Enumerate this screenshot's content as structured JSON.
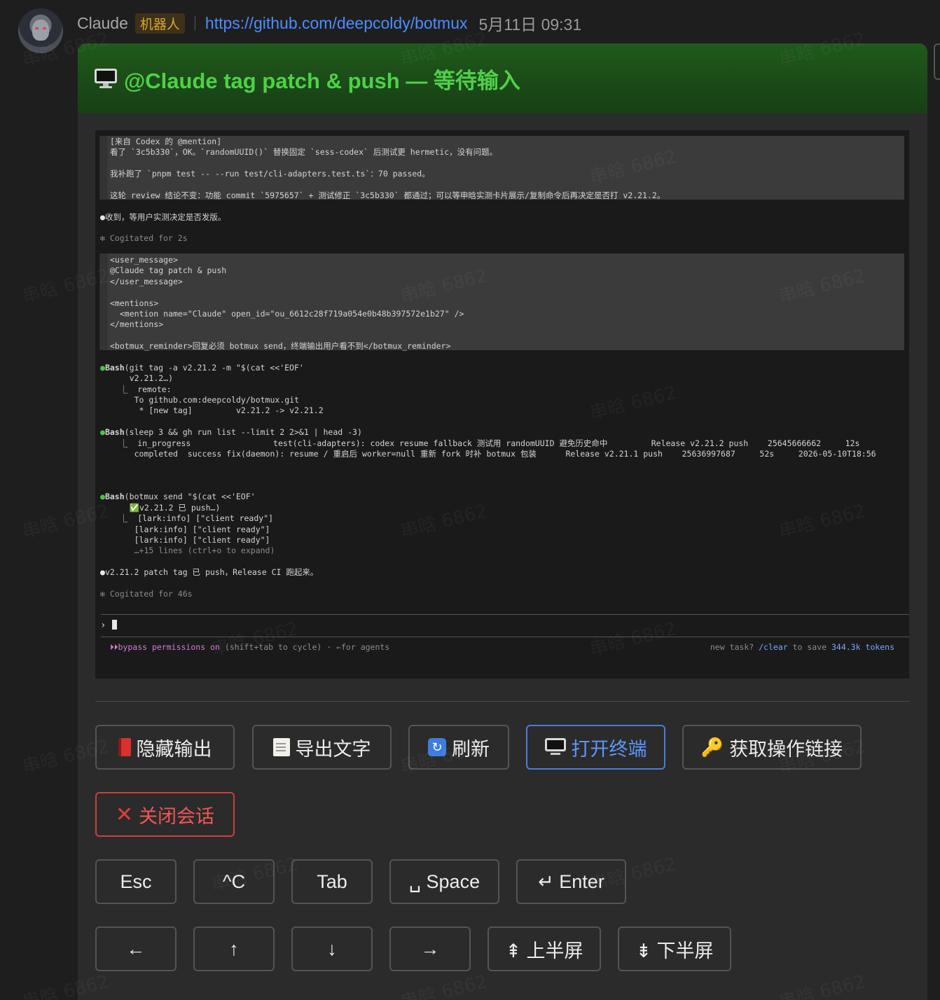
{
  "header": {
    "sender": "Claude",
    "badge": "机器人",
    "link": "https://github.com/deepcoldy/botmux",
    "time": "5月11日 09:31"
  },
  "watermark": "串晗 6862",
  "card": {
    "title": "@Claude tag patch & push — 等待输入"
  },
  "terminal": {
    "block1": [
      "[来自 Codex 的 @mention]",
      "看了 `3c5b330`，OK。`randomUUID()` 替换固定 `sess-codex` 后测试更 hermetic，没有问题。",
      "",
      "我补跑了 `pnpm test -- --run test/cli-adapters.test.ts`：70 passed。",
      "",
      "这轮 review 结论不变：功能 commit `5975657` + 测试修正 `3c5b330` 都通过；可以等申晗实测卡片展示/复制命令后再决定是否打 v2.21.2。"
    ],
    "reply1": "收到，等用户实测决定是否发版。",
    "cogitated1": "✻ Cogitated for 2s",
    "block2": [
      "<user_message>",
      "@Claude tag patch & push",
      "</user_message>",
      "",
      "<mentions>",
      "  <mention name=\"Claude\" open_id=\"ou_6612c28f719a054e0b48b397572e1b27\" />",
      "</mentions>",
      "",
      "<botmux_reminder>回复必须 botmux send，终端输出用户看不到</botmux_reminder>"
    ],
    "bash1": {
      "tool": "Bash",
      "cmd": "(git tag -a v2.21.2 -m \"$(cat <<'EOF'",
      "lines": [
        "    v2.21.2…)",
        "  ⎿  remote:",
        "     To github.com:deepcoldy/botmux.git",
        "      * [new tag]         v2.21.2 -> v2.21.2"
      ]
    },
    "bash2": {
      "tool": "Bash",
      "cmd": "(sleep 3 && gh run list --limit 2 2>&1 | head -3)",
      "lines": [
        "  ⎿  in_progress                 test(cli-adapters): codex resume fallback 测试用 randomUUID 避免历史命中         Release v2.21.2 push    25645666662     12s",
        "     completed  success fix(daemon): resume / 重启后 worker=null 重新 fork 时补 botmux 包装      Release v2.21.1 push    25636997687     52s     2026-05-10T18:56"
      ]
    },
    "bash3": {
      "tool": "Bash",
      "cmd": "(botmux send \"$(cat <<'EOF'",
      "lines": [
        "    ✅v2.21.2 已 push…)",
        "  ⎿  [lark:info] [\"client ready\"]",
        "     [lark:info] [\"client ready\"]",
        "     [lark:info] [\"client ready\"]",
        "     …+15 lines (ctrl+o to expand)"
      ]
    },
    "reply2": "v2.21.2 patch tag 已 push，Release CI 跑起来。",
    "cogitated2": "✻ Cogitated for 46s",
    "prompt": "›",
    "status_icon": "⏵⏵",
    "status_bypass": "bypass permissions on",
    "status_hint": " (shift+tab to cycle) · ←for agents",
    "status_new_task": "new task? ",
    "status_clear": "/clear",
    "status_to_save": " to save ",
    "status_tokens": "344.3k tokens"
  },
  "buttons": {
    "hide_output": "隐藏输出",
    "export_text": "导出文字",
    "refresh": "刷新",
    "open_terminal": "打开终端",
    "get_link": "获取操作链接",
    "close_session": "关闭会话",
    "esc": "Esc",
    "ctrl_c": "^C",
    "tab": "Tab",
    "space": "␣ Space",
    "enter": "↵ Enter",
    "left": "←",
    "up": "↑",
    "down": "↓",
    "right": "→",
    "page_up": "⇞ 上半屏",
    "page_down": "⇟ 下半屏"
  },
  "colors": {
    "title_green": "#4fd04a",
    "link_blue": "#4c8dff",
    "primary_border": "#4a7ddc",
    "danger": "#c9413f"
  }
}
